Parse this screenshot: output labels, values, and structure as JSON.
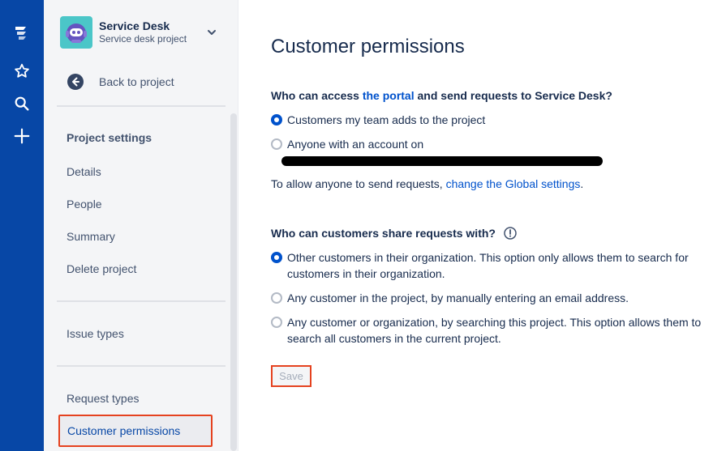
{
  "global_nav": {
    "icons": [
      "jira-logo-icon",
      "star-icon",
      "search-icon",
      "plus-icon"
    ]
  },
  "sidebar": {
    "project_name": "Service Desk",
    "project_type": "Service desk project",
    "back_label": "Back to project",
    "section_heading": "Project settings",
    "items": [
      {
        "label": "Details"
      },
      {
        "label": "People"
      },
      {
        "label": "Summary"
      },
      {
        "label": "Delete project"
      },
      {
        "label": "Issue types"
      },
      {
        "label": "Request types"
      },
      {
        "label": "Customer permissions"
      }
    ],
    "active_item": "Customer permissions"
  },
  "main": {
    "title": "Customer permissions",
    "access": {
      "question_prefix": "Who can access ",
      "question_link": "the portal",
      "question_suffix": " and send requests to Service Desk?",
      "options": [
        {
          "label": "Customers my team adds to the project",
          "checked": true
        },
        {
          "label": "Anyone with an account on",
          "checked": false
        }
      ],
      "global_prefix": "To allow anyone to send requests, ",
      "global_link": "change the Global settings",
      "global_suffix": "."
    },
    "share": {
      "question": "Who can customers share requests with?",
      "options": [
        {
          "label": "Other customers in their organization. This option only allows them to search for customers in their organization.",
          "checked": true
        },
        {
          "label": "Any customer in the project, by manually entering an email address.",
          "checked": false
        },
        {
          "label": "Any customer or organization, by searching this project. This option allows them to search all customers in the current project.",
          "checked": false
        }
      ]
    },
    "save_label": "Save"
  },
  "colors": {
    "global_nav_bg": "#0747a6",
    "link": "#0052cc",
    "highlight_border": "#e5421f"
  }
}
